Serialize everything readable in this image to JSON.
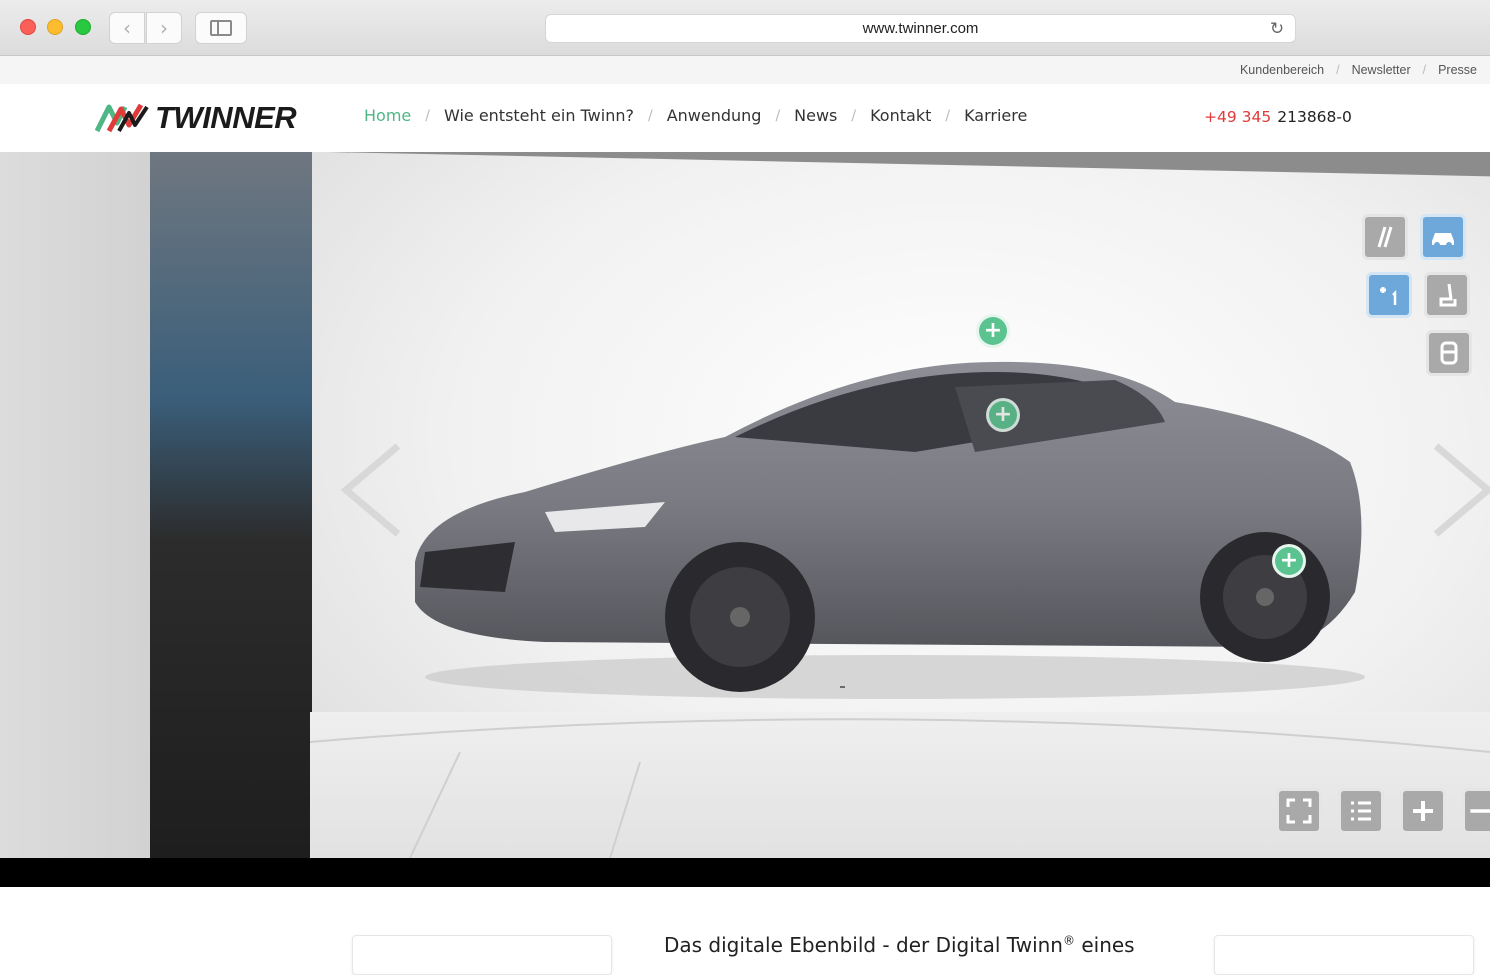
{
  "browser": {
    "url": "www.twinner.com"
  },
  "utility_links": [
    {
      "label": "Kundenbereich"
    },
    {
      "label": "Newsletter"
    },
    {
      "label": "Presse"
    }
  ],
  "brand": {
    "name": "TWINNER",
    "accent_green": "#4fb785",
    "accent_red": "#e03a3a"
  },
  "nav": {
    "items": [
      {
        "label": "Home",
        "active": true
      },
      {
        "label": "Wie entsteht ein Twinn?",
        "active": false
      },
      {
        "label": "Anwendung",
        "active": false
      },
      {
        "label": "News",
        "active": false
      },
      {
        "label": "Kontakt",
        "active": false
      },
      {
        "label": "Karriere",
        "active": false
      }
    ],
    "separator": "/"
  },
  "phone": {
    "prefix": "+49 345",
    "number": "213868-0"
  },
  "hero": {
    "icons": [
      "chevron-left-icon",
      "chevron-right-icon",
      "plus-hotspot-icon",
      "exterior-view-icon",
      "car-view-icon",
      "hotspot-toggle-icon",
      "seat-view-icon",
      "interior-view-icon",
      "fullscreen-icon",
      "list-icon",
      "zoom-in-icon",
      "zoom-out-icon"
    ]
  },
  "intro": {
    "text_before": "Das digitale Ebenbild - der Digital Twinn",
    "sup": "®",
    "text_after": " eines"
  }
}
